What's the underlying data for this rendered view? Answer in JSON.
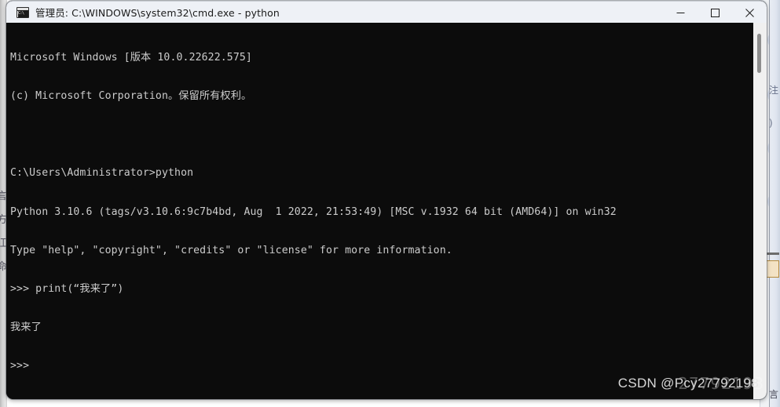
{
  "window": {
    "title": "管理员: C:\\WINDOWS\\system32\\cmd.exe - python",
    "icon": "cmd-console-icon",
    "titlebar_bg": "#eef1f6",
    "terminal_bg": "#0c0c0c",
    "terminal_fg": "#cccccc",
    "controls": {
      "minimize_label": "最小化",
      "maximize_label": "最大化",
      "close_label": "关闭"
    }
  },
  "terminal": {
    "lines": [
      "Microsoft Windows [版本 10.0.22622.575]",
      "(c) Microsoft Corporation。保留所有权利。",
      "",
      "C:\\Users\\Administrator>python",
      "Python 3.10.6 (tags/v3.10.6:9c7b4bd, Aug  1 2022, 21:53:49) [MSC v.1932 64 bit (AMD64)] on win32",
      "Type \"help\", \"copyright\", \"credits\" or \"license\" for more information.",
      ">>> print(“我来了”)",
      "我来了",
      ">>>"
    ]
  },
  "watermark": {
    "text": "CSDN @Pcy27792198",
    "ghost_text": "27792198"
  },
  "background": {
    "left_glyphs": "言\n方\n江\n命",
    "right_glyphs": "注\n)",
    "right_bottom_glyph": "言"
  }
}
